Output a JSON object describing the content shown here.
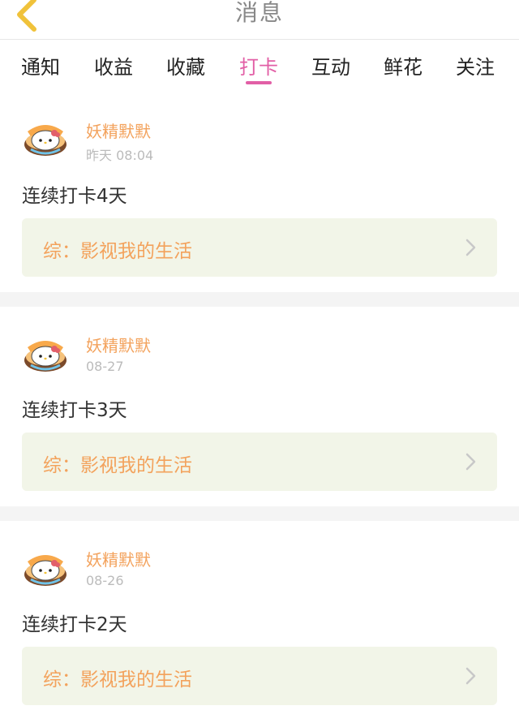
{
  "header": {
    "title": "消息",
    "back_icon": "chevron-left-icon",
    "accent_color": "#f0c23a"
  },
  "tabs": [
    {
      "label": "通知",
      "active": false
    },
    {
      "label": "收益",
      "active": false
    },
    {
      "label": "收藏",
      "active": false
    },
    {
      "label": "打卡",
      "active": true
    },
    {
      "label": "互动",
      "active": false
    },
    {
      "label": "鲜花",
      "active": false
    },
    {
      "label": "关注",
      "active": false
    }
  ],
  "active_tab_color": "#e25fa6",
  "cards": [
    {
      "username": "妖精默默",
      "time": "昨天 08:04",
      "message": "连续打卡4天",
      "topic": "综：影视我的生活"
    },
    {
      "username": "妖精默默",
      "time": "08-27",
      "message": "连续打卡3天",
      "topic": "综：影视我的生活"
    },
    {
      "username": "妖精默默",
      "time": "08-26",
      "message": "连续打卡2天",
      "topic": "综：影视我的生活"
    }
  ],
  "colors": {
    "username": "#f3a25c",
    "topic_bg": "#f2f5e8",
    "separator": "#f4f4f4"
  }
}
